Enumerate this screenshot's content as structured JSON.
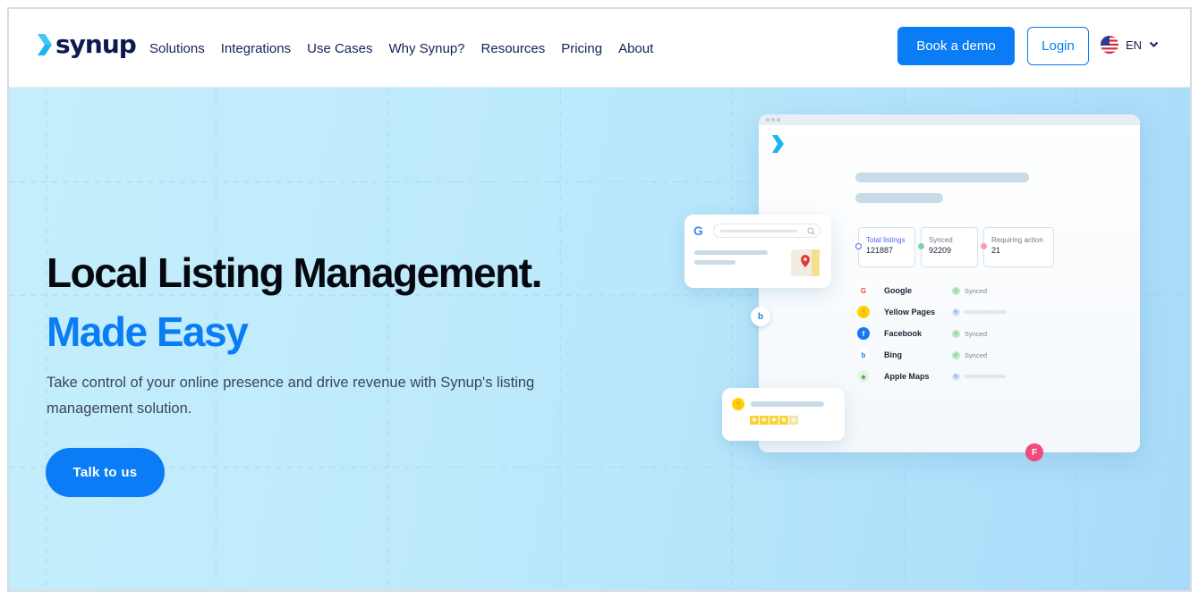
{
  "brand": {
    "name": "synup"
  },
  "nav": {
    "items": [
      {
        "label": "Solutions"
      },
      {
        "label": "Integrations"
      },
      {
        "label": "Use Cases"
      },
      {
        "label": "Why Synup?"
      },
      {
        "label": "Resources"
      },
      {
        "label": "Pricing"
      },
      {
        "label": "About"
      }
    ],
    "book_demo": "Book a demo",
    "login": "Login",
    "language": "EN"
  },
  "hero": {
    "title": "Local Listing Management.",
    "subtitle": "Made Easy",
    "description": "Take control of your online presence and drive revenue with Synup's listing management solution.",
    "cta": "Talk to us"
  },
  "dashboard": {
    "stats": [
      {
        "label": "Total listings",
        "value": "121887"
      },
      {
        "label": "Synced",
        "value": "92209"
      },
      {
        "label": "Requiring action",
        "value": "21"
      }
    ],
    "listings": [
      {
        "name": "Google",
        "icon": "google-icon",
        "status": "Synced"
      },
      {
        "name": "Yellow Pages",
        "icon": "yellow-pages-icon",
        "status": ""
      },
      {
        "name": "Facebook",
        "icon": "facebook-icon",
        "status": "Synced"
      },
      {
        "name": "Bing",
        "icon": "bing-icon",
        "status": "Synced"
      },
      {
        "name": "Apple Maps",
        "icon": "apple-maps-icon",
        "status": ""
      }
    ]
  },
  "colors": {
    "primary": "#0a7cf5",
    "navy": "#0d1a52",
    "hero_bg": "#bdeafb"
  }
}
